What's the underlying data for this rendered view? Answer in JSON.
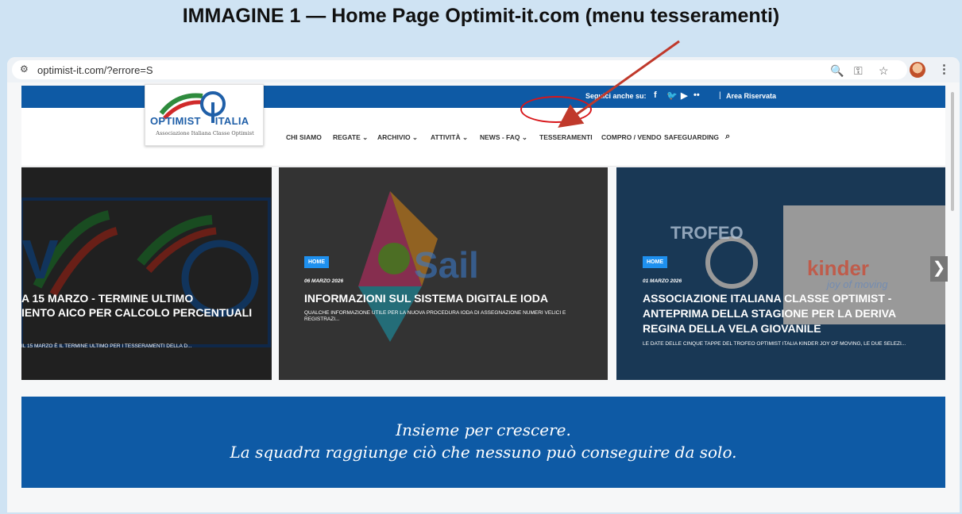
{
  "figure_title": "IMMAGINE 1 — Home Page Optimit-it.com (menu tesseramenti)",
  "browser": {
    "url": "optimist-it.com/?errore=S",
    "icons": [
      "site-settings-icon",
      "zoom-icon",
      "password-key-icon",
      "bookmark-star-icon",
      "profile-avatar",
      "more-menu-icon"
    ]
  },
  "site": {
    "follow_label": "Seguici anche su:",
    "social": [
      "f",
      "🐦",
      "▶",
      "••"
    ],
    "reserved_area": "Area Riservata",
    "logo": {
      "name_left": "OPTIMIST",
      "name_right": "ITALIA",
      "subtitle": "Associazione Italiana Classe Optimist"
    },
    "nav": [
      "CHI SIAMO",
      "REGATE ⌄",
      "ARCHIVIO ⌄",
      "ATTIVITÀ ⌄",
      "NEWS - FAQ ⌄",
      "TESSERAMENTI",
      "COMPRO / VENDO",
      "SAFEGUARDING",
      "⌕"
    ],
    "highlighted_nav": "TESSERAMENTI"
  },
  "slides": [
    {
      "title_line1": "A 15 MARZO - TERMINE ULTIMO",
      "title_line2": "IENTO AICO PER CALCOLO PERCENTUALI",
      "excerpt": "IL 15 MARZO È IL TERMINE ULTIMO PER I TESSERAMENTI DELLA D..."
    },
    {
      "category": "HOME",
      "date": "06 MARZO 2026",
      "title": "INFORMAZIONI SUL SISTEMA DIGITALE IODA",
      "excerpt": "QUALCHE INFORMAZIONE UTILE PER LA NUOVA PROCEDURA IODA DI ASSEGNAZIONE NUMERI VELICI E REGISTRAZI...",
      "bg_text": "Sail"
    },
    {
      "category": "HOME",
      "date": "01 MARZO 2026",
      "title_line1": "ASSOCIAZIONE ITALIANA CLASSE OPTIMIST -",
      "title_line2": "ANTEPRIMA DELLA STAGIONE PER LA DERIVA",
      "title_line3": "REGINA DELLA VELA GIOVANILE",
      "excerpt": "LE DATE DELLE CINQUE TAPPE DEL TROFEO OPTIMIST ITALIA KINDER JOY OF MOVING, LE DUE SELEZI...",
      "bg_text_1": "TROFEO",
      "bg_text_2": "kinder",
      "bg_text_3": "joy of moving"
    }
  ],
  "slider_next": "❯",
  "quote": {
    "line1": "Insieme per crescere.",
    "line2": "La squadra raggiunge ciò che nessuno può conseguire da solo."
  },
  "colors": {
    "brand_blue": "#0e5aa5",
    "badge_blue": "#1e90ef",
    "annotation_red": "#d8161a",
    "arrow_red": "#c0392b"
  }
}
